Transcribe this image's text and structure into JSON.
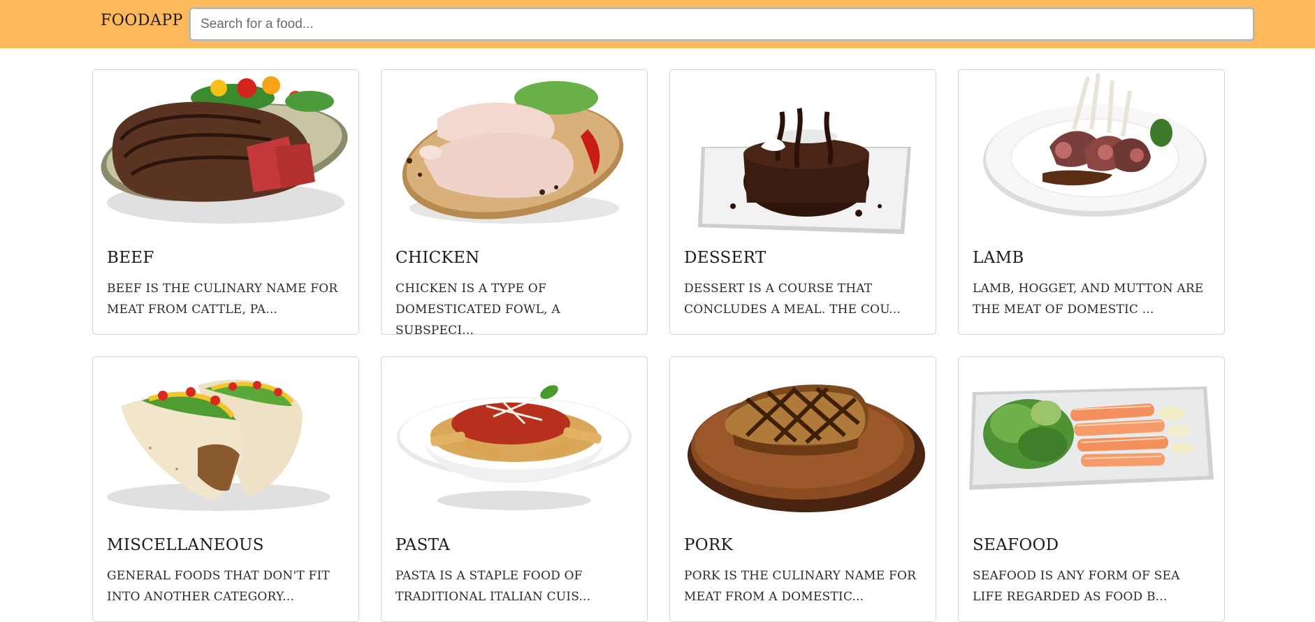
{
  "navbar": {
    "brand": "FOODAPP",
    "search": {
      "placeholder": "Search for a food...",
      "value": ""
    },
    "background_color": "#fdb95a"
  },
  "categories": [
    {
      "title": "BEEF",
      "description": "BEEF IS THE CULINARY NAME FOR MEAT FROM CATTLE, PA...",
      "image_icon": "beef-steak-plate"
    },
    {
      "title": "CHICKEN",
      "description": "CHICKEN IS A TYPE OF DOMESTICATED FOWL, A SUBSPECI...",
      "image_icon": "raw-chicken-board"
    },
    {
      "title": "DESSERT",
      "description": "DESSERT IS A COURSE THAT CONCLUDES A MEAL. THE COU...",
      "image_icon": "chocolate-cake-plate"
    },
    {
      "title": "LAMB",
      "description": "LAMB, HOGGET, AND MUTTON ARE THE MEAT OF DOMESTIC ...",
      "image_icon": "lamb-rack-plate"
    },
    {
      "title": "MISCELLANEOUS",
      "description": "GENERAL FOODS THAT DON'T FIT INTO ANOTHER CATEGORY...",
      "image_icon": "tacos"
    },
    {
      "title": "PASTA",
      "description": "PASTA IS A STAPLE FOOD OF TRADITIONAL ITALIAN CUIS...",
      "image_icon": "penne-bowl"
    },
    {
      "title": "PORK",
      "description": "PORK IS THE CULINARY NAME FOR MEAT FROM A DOMESTIC...",
      "image_icon": "pork-chop-board"
    },
    {
      "title": "SEAFOOD",
      "description": "SEAFOOD IS ANY FORM OF SEA LIFE REGARDED AS FOOD B...",
      "image_icon": "salmon-plate"
    }
  ]
}
